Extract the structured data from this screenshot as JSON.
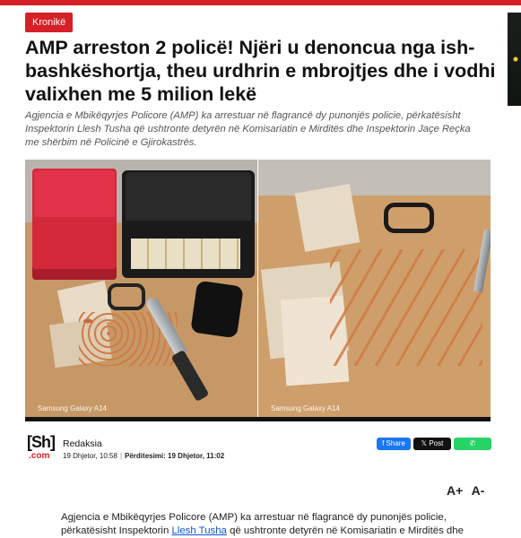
{
  "category": "Kronikë",
  "headline": "AMP arreston 2 policë! Njëri u denoncua nga ish-bashkëshortja, theu urdhrin e mbrojtjes dhe i vodhi valixhen me 5 milion lekë",
  "lead": "Agjencia e Mbikëqyrjes Policore (AMP) ka arrestuar në flagrancë dy punonjës policie, përkatësisht Inspektorin Llesh Tusha që ushtronte detyrën në Komisariatin e Mirditës dhe Inspektorin Jaçe Reçka me shërbim në Policinë e Gjirokastrës.",
  "photos": {
    "left_watermark": "Samsung Galaxy A14",
    "right_watermark": "Samsung Galaxy A14"
  },
  "byline": {
    "logo_top": "[Sh]",
    "logo_bottom": ".com",
    "author": "Redaksia",
    "date": "19 Dhjetor, 10:58",
    "updated_label": "Përditesimi:",
    "updated_value": "19 Dhjetor, 11:02"
  },
  "share": {
    "facebook": "f Share",
    "x": "𝕏 Post",
    "whatsapp": "✆"
  },
  "font_controls": {
    "increase": "A+",
    "decrease": "A-"
  },
  "body": {
    "text_before_link": "Agjencia e Mbikëqyrjes Policore (AMP) ka arrestuar në flagrancë dy punonjës policie, përkatësisht Inspektorin ",
    "link_text": "Llesh Tusha",
    "text_after_link": " që ushtronte detyrën në Komisariatin e Mirditës dhe"
  },
  "colors": {
    "brand": "#d61f26",
    "facebook": "#1877f2",
    "x": "#111111",
    "whatsapp": "#25d366"
  }
}
